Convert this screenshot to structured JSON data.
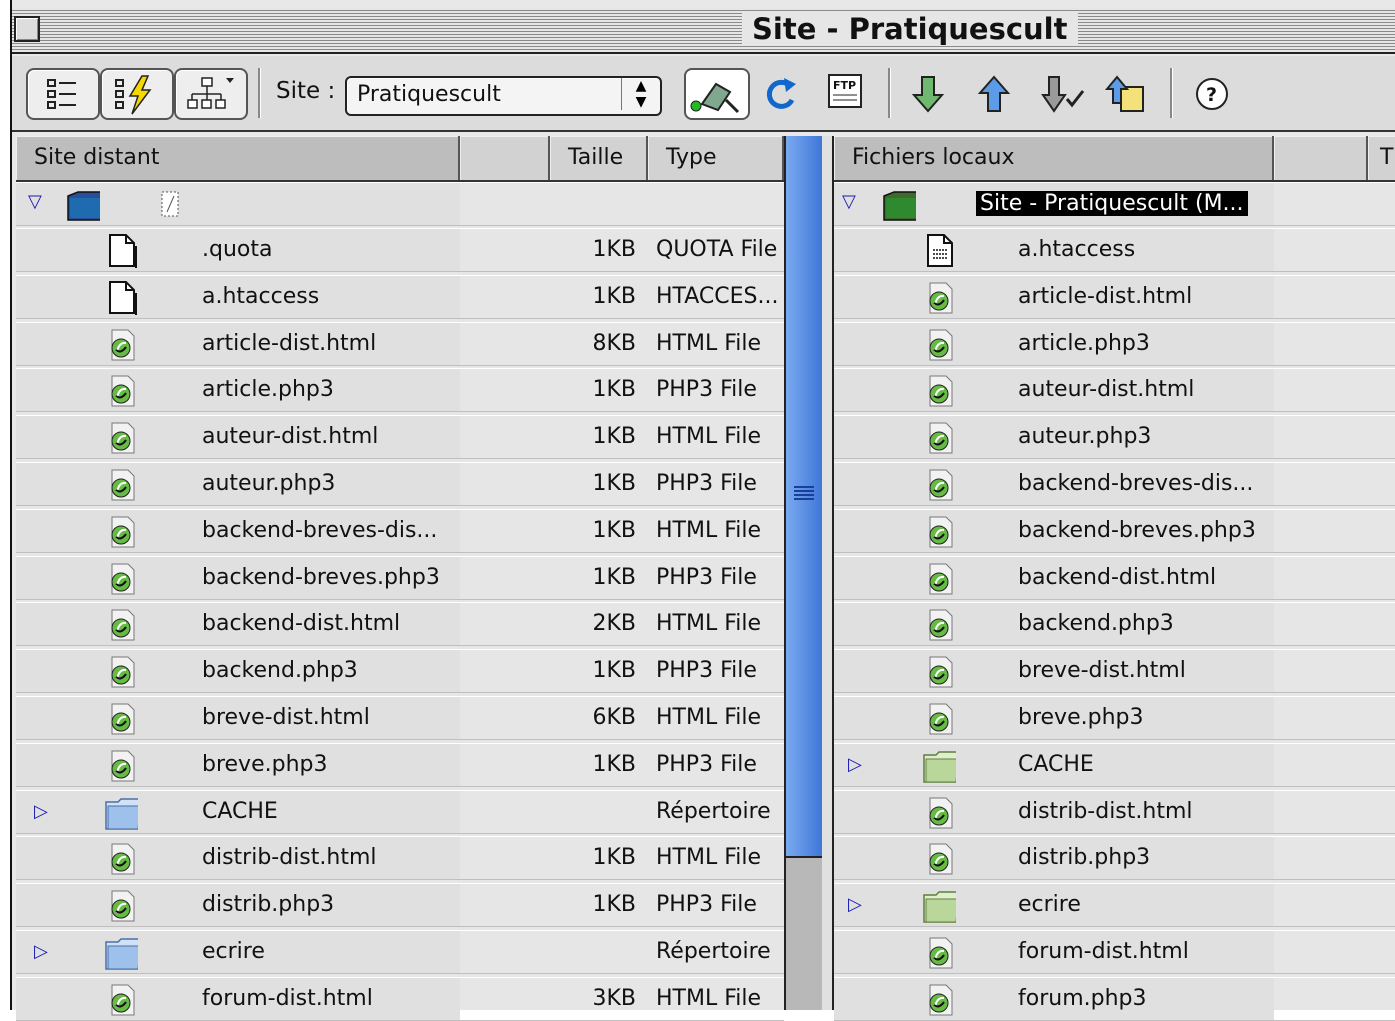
{
  "window": {
    "title": "Site - Pratiquescult"
  },
  "toolbar": {
    "site_label": "Site :",
    "site_value": "Pratiquescult",
    "ftp_label": "FTP",
    "help_label": "?"
  },
  "remote": {
    "headers": {
      "name": "Site distant",
      "size": "Taille",
      "type": "Type"
    },
    "root_label": "",
    "rows": [
      {
        "name": ".quota",
        "size": "1KB",
        "type": "QUOTA File",
        "icon": "blank-file-icon",
        "folder": false
      },
      {
        "name": "a.htaccess",
        "size": "1KB",
        "type": "HTACCES...",
        "icon": "blank-file-icon",
        "folder": false
      },
      {
        "name": "article-dist.html",
        "size": "8KB",
        "type": "HTML File",
        "icon": "web-file-icon",
        "folder": false
      },
      {
        "name": "article.php3",
        "size": "1KB",
        "type": "PHP3 File",
        "icon": "web-file-icon",
        "folder": false
      },
      {
        "name": "auteur-dist.html",
        "size": "1KB",
        "type": "HTML File",
        "icon": "web-file-icon",
        "folder": false
      },
      {
        "name": "auteur.php3",
        "size": "1KB",
        "type": "PHP3 File",
        "icon": "web-file-icon",
        "folder": false
      },
      {
        "name": "backend-breves-dis...",
        "size": "1KB",
        "type": "HTML File",
        "icon": "web-file-icon",
        "folder": false
      },
      {
        "name": "backend-breves.php3",
        "size": "1KB",
        "type": "PHP3 File",
        "icon": "web-file-icon",
        "folder": false
      },
      {
        "name": "backend-dist.html",
        "size": "2KB",
        "type": "HTML File",
        "icon": "web-file-icon",
        "folder": false
      },
      {
        "name": "backend.php3",
        "size": "1KB",
        "type": "PHP3 File",
        "icon": "web-file-icon",
        "folder": false
      },
      {
        "name": "breve-dist.html",
        "size": "6KB",
        "type": "HTML File",
        "icon": "web-file-icon",
        "folder": false
      },
      {
        "name": "breve.php3",
        "size": "1KB",
        "type": "PHP3 File",
        "icon": "web-file-icon",
        "folder": false
      },
      {
        "name": "CACHE",
        "size": "",
        "type": "Répertoire",
        "icon": "folder-icon",
        "folder": true
      },
      {
        "name": "distrib-dist.html",
        "size": "1KB",
        "type": "HTML File",
        "icon": "web-file-icon",
        "folder": false
      },
      {
        "name": "distrib.php3",
        "size": "1KB",
        "type": "PHP3 File",
        "icon": "web-file-icon",
        "folder": false
      },
      {
        "name": "ecrire",
        "size": "",
        "type": "Répertoire",
        "icon": "folder-icon",
        "folder": true
      },
      {
        "name": "forum-dist.html",
        "size": "3KB",
        "type": "HTML File",
        "icon": "web-file-icon",
        "folder": false
      }
    ]
  },
  "local": {
    "headers": {
      "name": "Fichiers locaux",
      "size": "T"
    },
    "root_label": "Site - Pratiquescult (M...",
    "rows": [
      {
        "name": "a.htaccess",
        "icon": "text-file-icon",
        "folder": false
      },
      {
        "name": "article-dist.html",
        "icon": "web-file-icon",
        "folder": false
      },
      {
        "name": "article.php3",
        "icon": "web-file-icon",
        "folder": false
      },
      {
        "name": "auteur-dist.html",
        "icon": "web-file-icon",
        "folder": false
      },
      {
        "name": "auteur.php3",
        "icon": "web-file-icon",
        "folder": false
      },
      {
        "name": "backend-breves-dis...",
        "icon": "web-file-icon",
        "folder": false
      },
      {
        "name": "backend-breves.php3",
        "icon": "web-file-icon",
        "folder": false
      },
      {
        "name": "backend-dist.html",
        "icon": "web-file-icon",
        "folder": false
      },
      {
        "name": "backend.php3",
        "icon": "web-file-icon",
        "folder": false
      },
      {
        "name": "breve-dist.html",
        "icon": "web-file-icon",
        "folder": false
      },
      {
        "name": "breve.php3",
        "icon": "web-file-icon",
        "folder": false
      },
      {
        "name": "CACHE",
        "icon": "folder-icon",
        "folder": true
      },
      {
        "name": "distrib-dist.html",
        "icon": "web-file-icon",
        "folder": false
      },
      {
        "name": "distrib.php3",
        "icon": "web-file-icon",
        "folder": false
      },
      {
        "name": "ecrire",
        "icon": "folder-icon",
        "folder": true
      },
      {
        "name": "forum-dist.html",
        "icon": "web-file-icon",
        "folder": false
      },
      {
        "name": "forum.php3",
        "icon": "web-file-icon",
        "folder": false
      }
    ]
  },
  "colors": {
    "scroll_thumb": "#5b8fe6",
    "selection": "#000000",
    "accent_blue": "#1b1bb0"
  }
}
